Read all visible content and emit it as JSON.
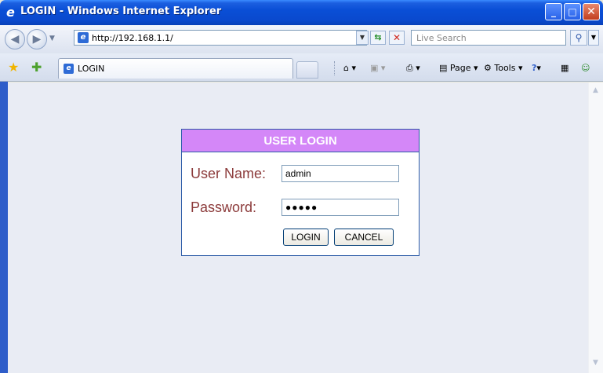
{
  "window": {
    "title": "LOGIN - Windows Internet Explorer",
    "title_icon": "ie-logo",
    "minimize": "‒",
    "maximize": "□",
    "close": "✕"
  },
  "navigation": {
    "back_icon": "back-arrow-icon",
    "forward_icon": "forward-arrow-icon",
    "address": "http://192.168.1.1/",
    "search_placeholder": "Live Search"
  },
  "tabs": [
    {
      "label": "LOGIN"
    }
  ],
  "commandbar": {
    "page_label": "Page",
    "tools_label": "Tools"
  },
  "login": {
    "header": "USER LOGIN",
    "username_label": "User Name:",
    "username_value": "admin",
    "password_label": "Password:",
    "password_mask": "●●●●●",
    "login_button": "LOGIN",
    "cancel_button": "CANCEL"
  },
  "colors": {
    "header_bg": "#D487F8",
    "label_color": "#8C3B3B",
    "content_bg": "#E9ECF4",
    "titlebar": "#0A4FD6"
  }
}
